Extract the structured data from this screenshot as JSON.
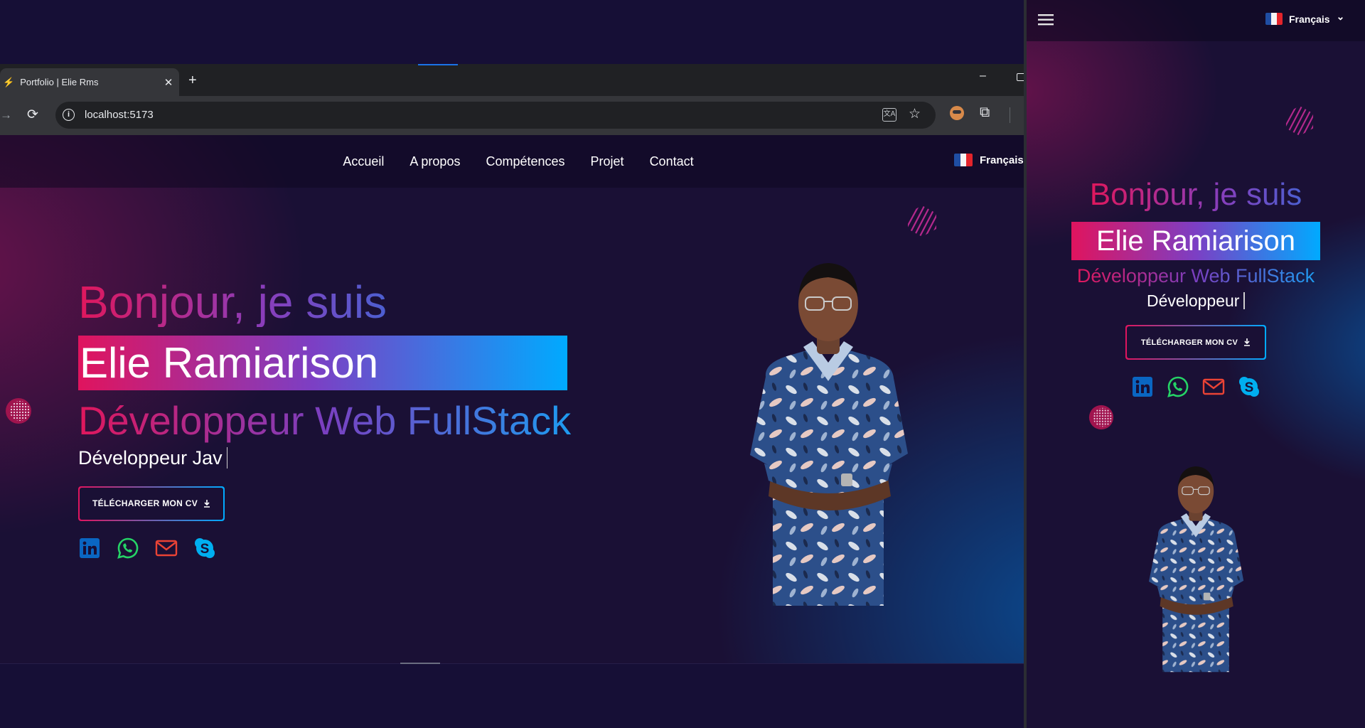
{
  "browser": {
    "tab_title": "Portfolio | Elie Rms",
    "tab_close": "✕",
    "new_tab": "+",
    "minimize": "–",
    "url": "localhost:5173",
    "reload": "⟳",
    "forward": "→",
    "star": "☆",
    "info": "i",
    "translate": "文A",
    "extensions": "⧉"
  },
  "nav": {
    "items": [
      "Accueil",
      "A propos",
      "Compétences",
      "Projet",
      "Contact"
    ],
    "lang": "Français",
    "lang_mobile": "Français",
    "chevron": "⌄"
  },
  "hero": {
    "greeting": "Bonjour, je suis",
    "name": "Elie Ramiarison",
    "role": "Développeur Web FullStack",
    "typed_desktop": "Développeur Jav",
    "typed_mobile": "Développeur",
    "cv_button": "TÉLÉCHARGER MON CV",
    "cv_icon": "download-icon"
  },
  "socials": [
    "linkedin-icon",
    "whatsapp-icon",
    "mail-icon",
    "skype-icon"
  ],
  "colors": {
    "background": "#1a1035",
    "accent_pink": "#e0145e",
    "accent_blue": "#00aaff",
    "linkedin": "#0a66c2",
    "whatsapp": "#25d366",
    "mail": "#ea4335",
    "skype": "#00aff0"
  },
  "mobile": {
    "menu_icon": "hamburger-icon"
  }
}
